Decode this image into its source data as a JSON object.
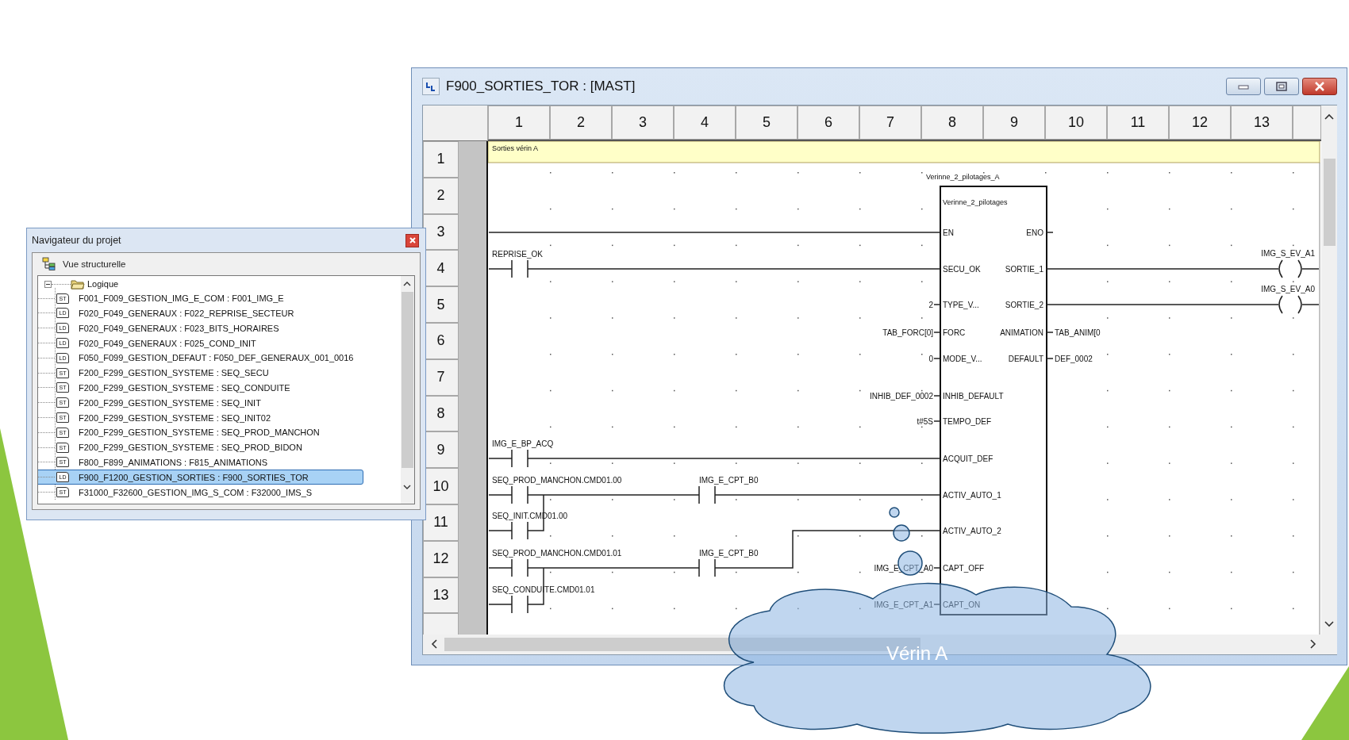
{
  "navigator": {
    "title": "Navigateur du projet",
    "view": "Vue structurelle",
    "tree": {
      "label": "Logique",
      "expanded": true,
      "children": [
        {
          "tag": "ST",
          "label": "F001_F009_GESTION_IMG_E_COM : F001_IMG_E",
          "selected": false
        },
        {
          "tag": "LD",
          "label": "F020_F049_GENERAUX : F022_REPRISE_SECTEUR",
          "selected": false
        },
        {
          "tag": "LD",
          "label": "F020_F049_GENERAUX : F023_BITS_HORAIRES",
          "selected": false
        },
        {
          "tag": "LD",
          "label": "F020_F049_GENERAUX : F025_COND_INIT",
          "selected": false
        },
        {
          "tag": "LD",
          "label": "F050_F099_GESTION_DEFAUT : F050_DEF_GENERAUX_001_0016",
          "selected": false
        },
        {
          "tag": "ST",
          "label": "F200_F299_GESTION_SYSTEME : SEQ_SECU",
          "selected": false
        },
        {
          "tag": "ST",
          "label": "F200_F299_GESTION_SYSTEME : SEQ_CONDUITE",
          "selected": false
        },
        {
          "tag": "ST",
          "label": "F200_F299_GESTION_SYSTEME : SEQ_INIT",
          "selected": false
        },
        {
          "tag": "ST",
          "label": "F200_F299_GESTION_SYSTEME : SEQ_INIT02",
          "selected": false
        },
        {
          "tag": "ST",
          "label": "F200_F299_GESTION_SYSTEME : SEQ_PROD_MANCHON",
          "selected": false
        },
        {
          "tag": "ST",
          "label": "F200_F299_GESTION_SYSTEME : SEQ_PROD_BIDON",
          "selected": false
        },
        {
          "tag": "ST",
          "label": "F800_F899_ANIMATIONS : F815_ANIMATIONS",
          "selected": false
        },
        {
          "tag": "LD",
          "label": "F900_F1200_GESTION_SORTIES : F900_SORTIES_TOR",
          "selected": true
        },
        {
          "tag": "ST",
          "label": "F31000_F32600_GESTION_IMG_S_COM : F32000_IMS_S",
          "selected": false
        }
      ]
    }
  },
  "ladder_window": {
    "title": "F900_SORTIES_TOR : [MAST]",
    "columns": [
      "1",
      "2",
      "3",
      "4",
      "5",
      "6",
      "7",
      "8",
      "9",
      "10",
      "11",
      "12",
      "13"
    ],
    "rows": [
      "1",
      "2",
      "3",
      "4",
      "5",
      "6",
      "7",
      "8",
      "9",
      "10",
      "11",
      "12",
      "13"
    ],
    "comment": "Sorties vérin A",
    "block": {
      "instance": "Verinne_2_pilotages_A",
      "type": "Verinne_2_pilotages",
      "inputs": [
        {
          "pin": "EN"
        },
        {
          "pin": "SECU_OK"
        },
        {
          "pin": "TYPE_V...",
          "value": "2"
        },
        {
          "pin": "FORC",
          "value": "TAB_FORC[0]"
        },
        {
          "pin": "MODE_V...",
          "value": "0"
        },
        {
          "pin": "INHIB_DEFAULT",
          "value": "INHIB_DEF_0002"
        },
        {
          "pin": "TEMPO_DEF",
          "value": "t#5S"
        },
        {
          "pin": "ACQUIT_DEF"
        },
        {
          "pin": "ACTIV_AUTO_1"
        },
        {
          "pin": "ACTIV_AUTO_2"
        },
        {
          "pin": "CAPT_OFF",
          "value": "IMG_E_CPT_A0"
        },
        {
          "pin": "CAPT_ON",
          "value": "IMG_E_CPT_A1"
        }
      ],
      "outputs": [
        {
          "pin": "ENO"
        },
        {
          "pin": "SORTIE_1"
        },
        {
          "pin": "SORTIE_2"
        },
        {
          "pin": "ANIMATION",
          "value": "TAB_ANIM[0"
        },
        {
          "pin": "DEFAULT",
          "value": "DEF_0002"
        }
      ]
    },
    "contacts": [
      {
        "label": "REPRISE_OK"
      },
      {
        "label": "IMG_E_BP_ACQ"
      },
      {
        "label": "SEQ_PROD_MANCHON.CMD01.00"
      },
      {
        "label": "IMG_E_CPT_B0"
      },
      {
        "label": "SEQ_INIT.CMD01.00"
      },
      {
        "label": "SEQ_PROD_MANCHON.CMD01.01"
      },
      {
        "label": "IMG_E_CPT_B0"
      },
      {
        "label": "SEQ_CONDUITE.CMD01.01"
      }
    ],
    "coils": [
      {
        "label": "IMG_S_EV_A1"
      },
      {
        "label": "IMG_S_EV_A0"
      }
    ]
  },
  "callout": {
    "text": "Vérin A"
  }
}
